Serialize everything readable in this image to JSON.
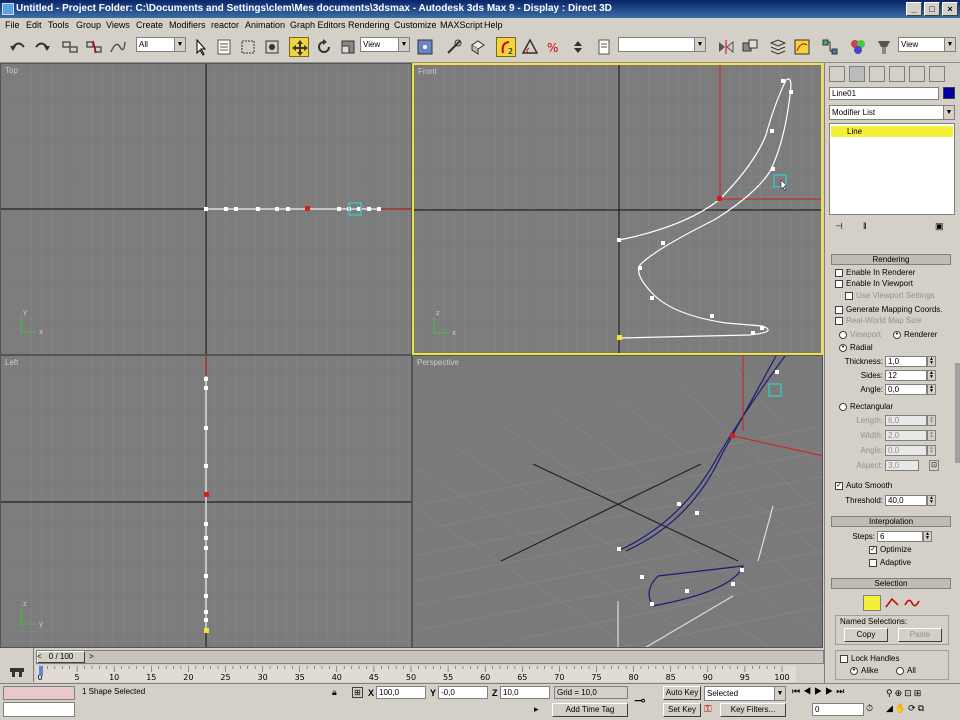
{
  "window": {
    "title": "Untitled     - Project Folder: C:\\Documents and Settings\\clem\\Mes documents\\3dsmax     - Autodesk 3ds Max 9        - Display : Direct 3D"
  },
  "menu": [
    "File",
    "Edit",
    "Tools",
    "Group",
    "Views",
    "Create",
    "Modifiers",
    "reactor",
    "Animation",
    "Graph Editors",
    "Rendering",
    "Customize",
    "MAXScript",
    "Help"
  ],
  "toolbar": {
    "selection_filter": "All",
    "ref_coord": "View",
    "named_selection": "",
    "view_combo": "View"
  },
  "viewports": {
    "top": "Top",
    "front": "Front",
    "left": "Left",
    "perspective": "Perspective"
  },
  "panel": {
    "object_name": "Line01",
    "object_color": "#0000a0",
    "modifier_list": "Modifier List",
    "stack_item": "Line",
    "rendering": {
      "header": "Rendering",
      "enable_renderer": "Enable In Renderer",
      "enable_viewport": "Enable In Viewport",
      "use_viewport_settings": "Use Viewport Settings",
      "generate_mapping": "Generate Mapping Coords.",
      "real_world": "Real-World Map Size",
      "viewport": "Viewport",
      "renderer": "Renderer",
      "radial": "Radial",
      "thickness_label": "Thickness:",
      "thickness": "1,0",
      "sides_label": "Sides:",
      "sides": "12",
      "angle_label": "Angle:",
      "angle": "0,0",
      "rectangular": "Rectangular",
      "length_label": "Length:",
      "length": "6,0",
      "width_label": "Width:",
      "width": "2,0",
      "angle2_label": "Angle:",
      "angle2": "0,0",
      "aspect_label": "Aspect:",
      "aspect": "3,0",
      "auto_smooth": "Auto Smooth",
      "threshold_label": "Threshold:",
      "threshold": "40,0"
    },
    "interpolation": {
      "header": "Interpolation",
      "steps_label": "Steps:",
      "steps": "6",
      "optimize": "Optimize",
      "adaptive": "Adaptive"
    },
    "selection": {
      "header": "Selection",
      "named_selections": "Named Selections:",
      "copy": "Copy",
      "paste": "Paste",
      "lock_handles": "Lock Handles",
      "alike": "Alike",
      "all": "All"
    }
  },
  "timeline": {
    "slider": "0 / 100",
    "ticks": [
      "0",
      "5",
      "10",
      "15",
      "20",
      "25",
      "30",
      "35",
      "40",
      "45",
      "50",
      "55",
      "60",
      "65",
      "70",
      "75",
      "80",
      "85",
      "90",
      "95",
      "100"
    ]
  },
  "status": {
    "selected": "1 Shape Selected",
    "x": "100,0",
    "y": "-0,0",
    "z": "10,0",
    "grid": "Grid = 10,0",
    "add_time_tag": "Add Time Tag",
    "auto_key": "Auto Key",
    "set_key": "Set Key",
    "key_mode": "Selected",
    "key_filters": "Key Filters...",
    "frame": "0"
  }
}
